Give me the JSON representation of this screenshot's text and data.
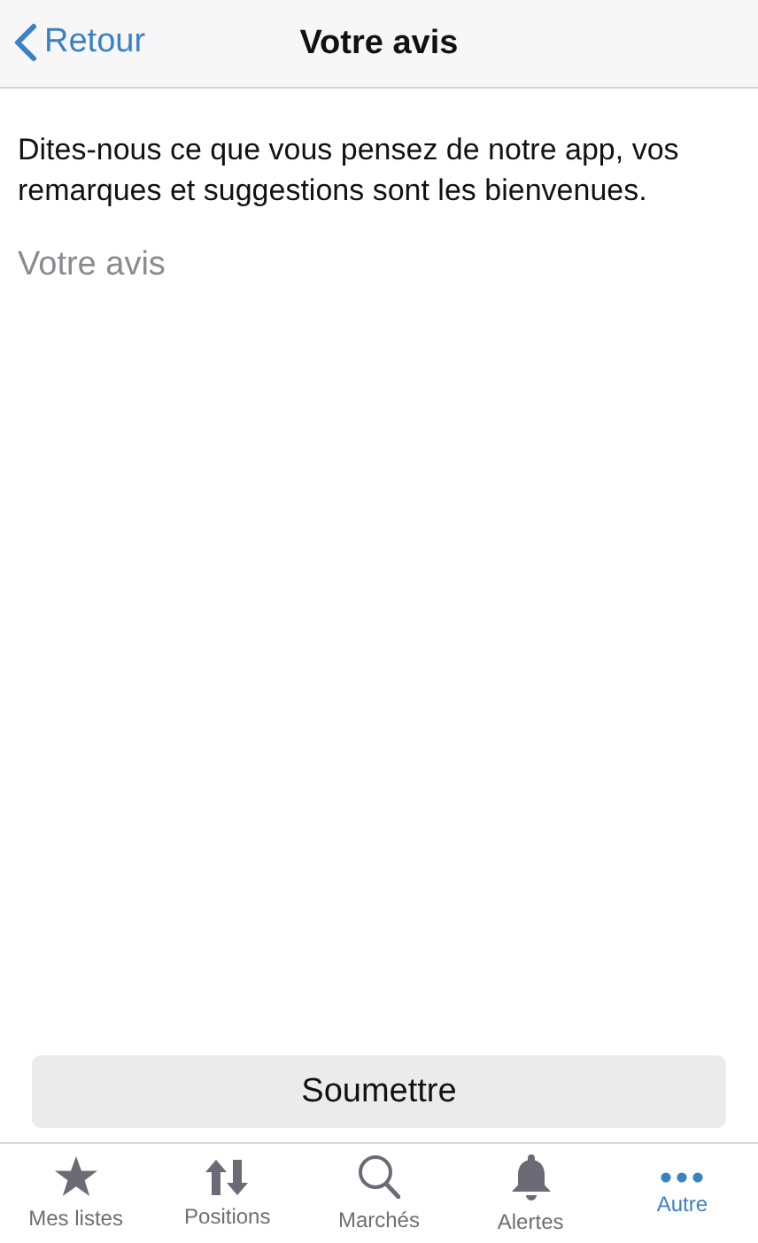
{
  "nav_bar": {
    "back": "Retour",
    "title": "Votre avis"
  },
  "intro": "Dites-nous ce que vous pensez de notre app, vos remarques et suggestions sont les bienvenues.",
  "feedback_field": {
    "placeholder": "Votre avis"
  },
  "submit_button": "Soumettre",
  "tab_bar": [
    {
      "kind": "star",
      "label": "Mes listes",
      "selected": false
    },
    {
      "kind": "arrows",
      "label": "Positions",
      "selected": false
    },
    {
      "kind": "search",
      "label": "Marchés",
      "selected": false
    },
    {
      "kind": "bell",
      "label": "Alertes",
      "selected": false
    },
    {
      "kind": "more",
      "label": "Autre",
      "selected": true
    }
  ]
}
